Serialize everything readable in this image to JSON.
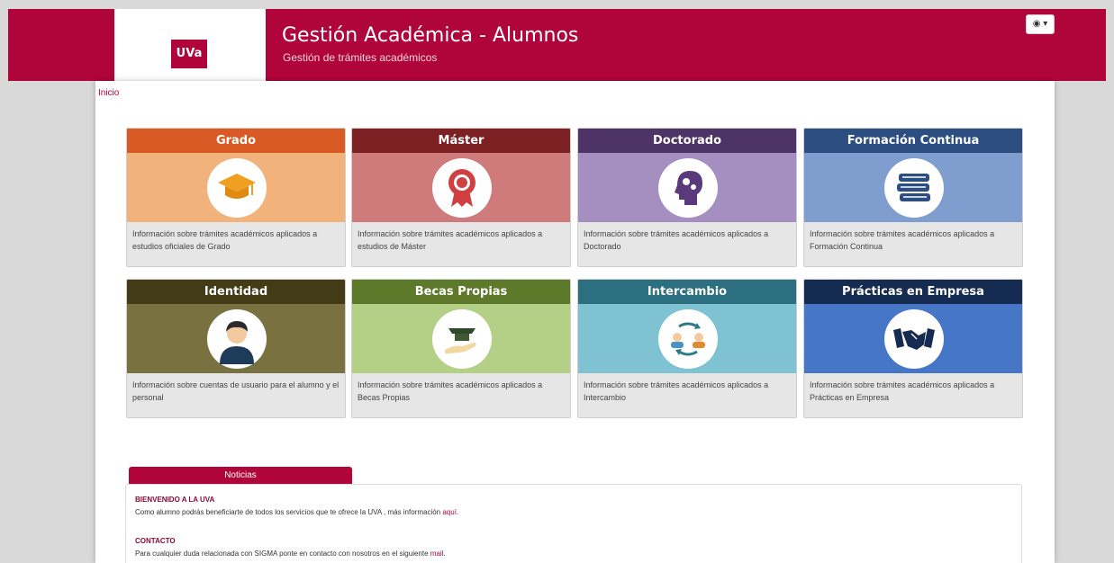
{
  "header": {
    "logo_text": "UVa",
    "title": "Gestión Académica - Alumnos",
    "subtitle": "Gestión de trámites académicos",
    "lang_button": "◉ ▾"
  },
  "breadcrumb": {
    "home": "Inicio"
  },
  "cards": [
    {
      "title": "Grado",
      "desc": "Información sobre trámites académicos aplicados a estudios oficiales de Grado",
      "icon": "graduation-cap-icon",
      "head_color": "#d95a25",
      "body_color": "#f2b27b"
    },
    {
      "title": "Máster",
      "desc": "Información sobre trámites académicos aplicados a estudios de Máster",
      "icon": "award-ribbon-icon",
      "head_color": "#7d2024",
      "body_color": "#cf7b7b"
    },
    {
      "title": "Doctorado",
      "desc": "Información sobre trámites académicos aplicados a Doctorado",
      "icon": "brain-gears-icon",
      "head_color": "#4e3466",
      "body_color": "#a58ec0"
    },
    {
      "title": "Formación Continua",
      "desc": "Información sobre trámites académicos aplicados a Formación Continua",
      "icon": "books-stack-icon",
      "head_color": "#2d4e80",
      "body_color": "#7f9ecf"
    },
    {
      "title": "Identidad",
      "desc": "Información sobre cuentas de usuario para el alumno y el personal",
      "icon": "user-avatar-icon",
      "head_color": "#433a16",
      "body_color": "#7a7141"
    },
    {
      "title": "Becas Propias",
      "desc": "Información sobre trámites académicos aplicados a Becas Propias",
      "icon": "scholarship-hand-icon",
      "head_color": "#5d7a2b",
      "body_color": "#b4cf86"
    },
    {
      "title": "Intercambio",
      "desc": "Información sobre trámites académicos aplicados a Intercambio",
      "icon": "exchange-users-icon",
      "head_color": "#2c6f80",
      "body_color": "#7fc2d2"
    },
    {
      "title": "Prácticas en Empresa",
      "desc": "Información sobre trámites académicos aplicados a Prácticas en Empresa",
      "icon": "handshake-icon",
      "head_color": "#152b52",
      "body_color": "#4677c7"
    }
  ],
  "news": {
    "tab_label": "Noticias",
    "items": [
      {
        "title": "BIENVENIDO A LA UVA",
        "text": "Como alumno podrás beneficiarte de todos los servicios que te ofrece la UVA , más información ",
        "link": "aquí",
        "suffix": "."
      },
      {
        "title": "CONTACTO",
        "text": "Para cualquier duda relacionada con SIGMA ponte en contacto con nosotros en el siguiente ",
        "link": "mail",
        "suffix": "."
      }
    ]
  }
}
